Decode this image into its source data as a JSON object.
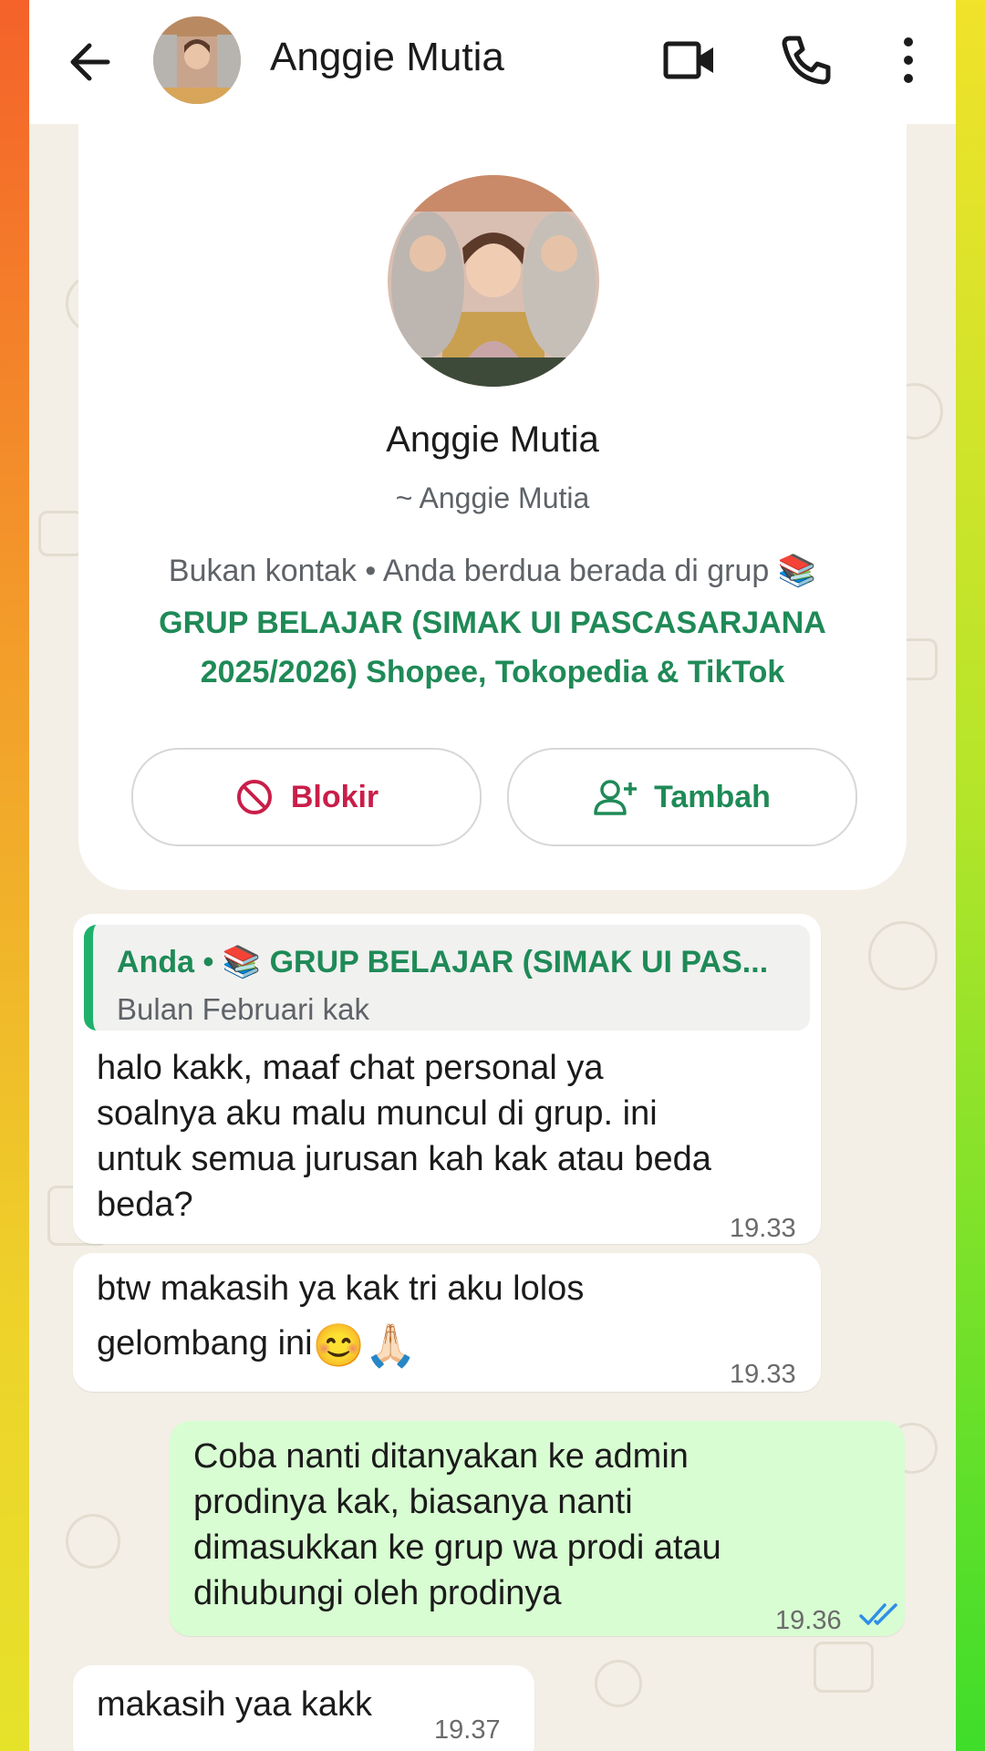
{
  "header": {
    "contact_name": "Anggie Mutia",
    "icons": [
      "back-arrow-icon",
      "video-call-icon",
      "phone-call-icon",
      "more-options-icon"
    ]
  },
  "profile": {
    "name": "Anggie Mutia",
    "push_name": "~ Anggie Mutia",
    "info": "Bukan kontak • Anda berdua berada di grup 📚",
    "group_line1": "GRUP BELAJAR (SIMAK UI PASCASARJANA",
    "group_line2": "2025/2026) Shopee, Tokopedia & TikTok",
    "block_label": "Blokir",
    "add_label": "Tambah"
  },
  "messages": [
    {
      "direction": "in",
      "quote_title": "Anda • 📚 GRUP BELAJAR (SIMAK UI PAS...",
      "quote_text": "Bulan Februari kak",
      "lines": [
        "halo kakk, maaf chat personal ya",
        "soalnya aku malu muncul di grup. ini",
        "untuk semua jurusan kah kak atau beda",
        "beda?"
      ],
      "time": "19.33"
    },
    {
      "direction": "in",
      "lines": [
        "btw makasih ya kak tri aku lolos",
        "gelombang ini"
      ],
      "emoji": "😊🙏🏻",
      "time": "19.33"
    },
    {
      "direction": "out",
      "lines": [
        "Coba nanti ditanyakan ke admin",
        "prodinya kak, biasanya nanti",
        "dimasukkan ke grup wa prodi atau",
        "dihubungi oleh prodinya"
      ],
      "time": "19.36",
      "status": "read"
    },
    {
      "direction": "in",
      "lines": [
        "makasih yaa kakk"
      ],
      "time": "19.37"
    }
  ],
  "colors": {
    "accent_green": "#1f8a57",
    "block_red": "#c91e49",
    "outgoing_bubble": "#d8fdd2",
    "read_tick_blue": "#2f8ee8"
  }
}
